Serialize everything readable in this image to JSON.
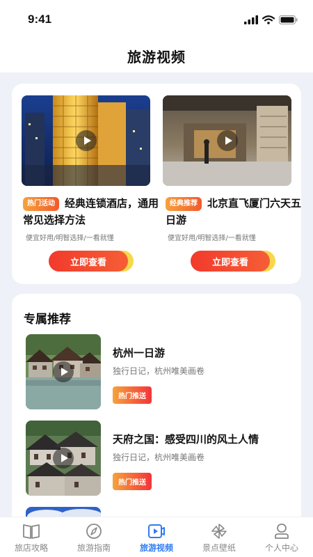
{
  "status": {
    "time": "9:41"
  },
  "header": {
    "title": "旅游视频"
  },
  "featured": [
    {
      "badge": "热门活动",
      "title": "经典连锁酒店，通用常见选择方法",
      "subtitle": "便宜好用/明智选择/一看就懂",
      "button": "立即查看"
    },
    {
      "badge": "经典推荐",
      "title": "北京直飞厦门六天五日游",
      "subtitle": "便宜好用/明智选择/一看就懂",
      "button": "立即查看"
    }
  ],
  "recommend": {
    "title": "专属推荐",
    "items": [
      {
        "title": "杭州一日游",
        "subtitle": "独行日记，杭州唯美画卷",
        "badge": "热门推送"
      },
      {
        "title": "天府之国：感受四川的风土人情",
        "subtitle": "独行日记，杭州唯美画卷",
        "badge": "热门推送"
      }
    ]
  },
  "tabs": [
    {
      "label": "旅店攻略",
      "icon": "book-icon"
    },
    {
      "label": "旅游指南",
      "icon": "compass-icon"
    },
    {
      "label": "旅游视频",
      "icon": "video-play-icon",
      "active": true
    },
    {
      "label": "景点壁纸",
      "icon": "pinwheel-icon"
    },
    {
      "label": "个人中心",
      "icon": "person-icon"
    }
  ],
  "colors": {
    "accent": "#2f7bf4",
    "button": "#f23a2c",
    "badge": "#f7a23b"
  }
}
